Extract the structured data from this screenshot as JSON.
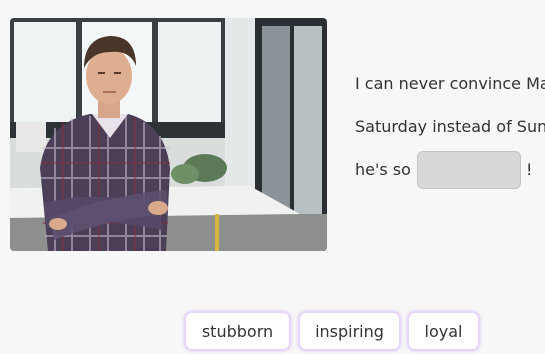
{
  "exercise": {
    "sentence_line1": "I can never convince Ma",
    "sentence_line2": "Saturday instead of Sun",
    "sentence_line3_prefix": "he's so",
    "sentence_line3_suffix": "!"
  },
  "word_bank": {
    "options": [
      "stubborn",
      "inspiring",
      "loyal"
    ]
  },
  "illustration": {
    "subject": "man-arms-crossed-office-photo"
  },
  "colors": {
    "background": "#f7f7f7",
    "blank_fill": "#d8d8d8",
    "option_border": "#e6d6fb",
    "text": "#333333"
  }
}
